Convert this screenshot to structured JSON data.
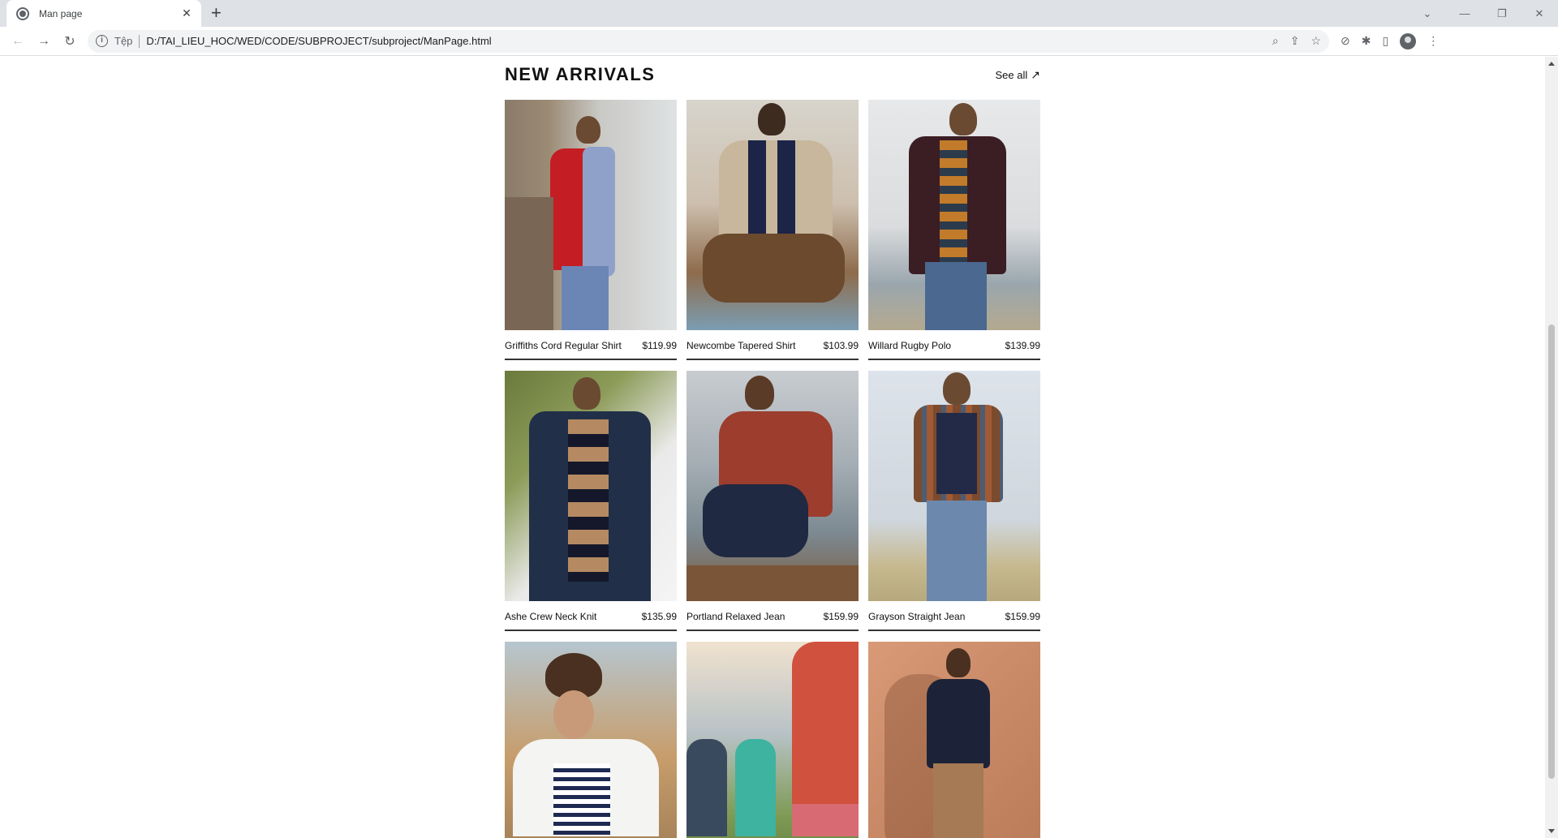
{
  "browser": {
    "tab_title": "Man page",
    "tab_close": "✕",
    "new_tab": "+",
    "window_controls": [
      "⌄",
      "—",
      "❐",
      "✕"
    ],
    "address_label": "Tệp",
    "url": "D:/TAI_LIEU_HOC/WED/CODE/SUBPROJECT/subproject/ManPage.html",
    "back_icon": "←",
    "forward_icon": "→",
    "reload_icon": "↻",
    "zoom_icon": "⌕",
    "share_icon": "⇪",
    "star_icon": "☆",
    "extension_icon": "✱",
    "sidepanel_icon": "▯",
    "menu_icon": "⋮",
    "compass_icon": "⊘"
  },
  "section": {
    "title": "NEW ARRIVALS",
    "see_all": "See all",
    "see_all_arrow": "↗"
  },
  "products": [
    {
      "name": "Griffiths Cord Regular Shirt",
      "price": "$119.99"
    },
    {
      "name": "Newcombe Tapered Shirt",
      "price": "$103.99"
    },
    {
      "name": "Willard Rugby Polo",
      "price": "$139.99"
    },
    {
      "name": "Ashe Crew Neck Knit",
      "price": "$135.99"
    },
    {
      "name": "Portland Relaxed Jean",
      "price": "$159.99"
    },
    {
      "name": "Grayson Straight Jean",
      "price": "$159.99"
    }
  ]
}
